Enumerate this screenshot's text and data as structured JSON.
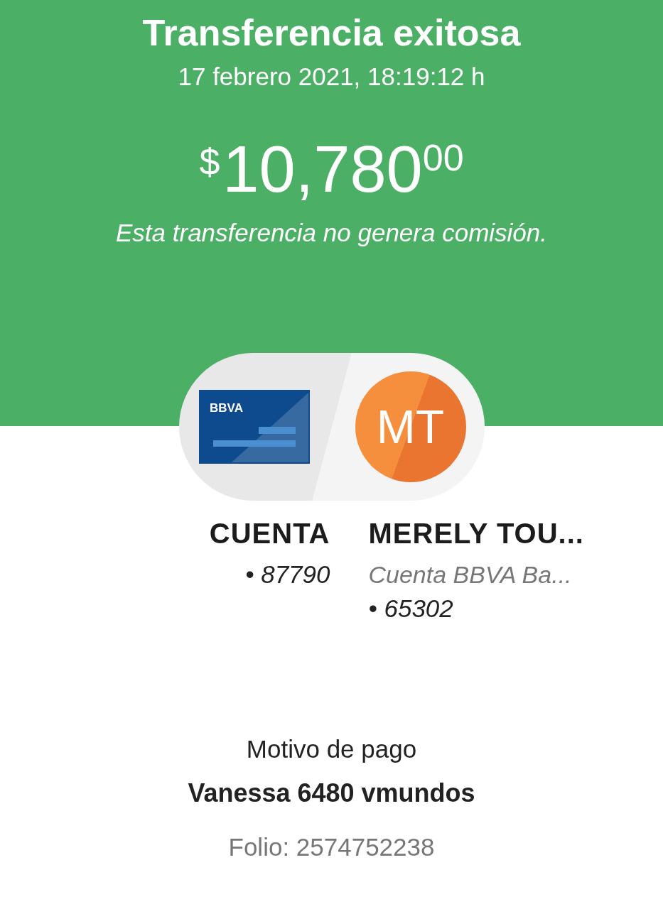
{
  "header": {
    "title": "Transferencia exitosa",
    "datetime": "17 febrero 2021, 18:19:12 h"
  },
  "amount": {
    "currency": "$",
    "integer": "10,780",
    "cents": "00"
  },
  "note": "Esta transferencia no genera comisión.",
  "origin": {
    "bank_logo_text": "BBVA",
    "name": "CUENTA",
    "lines": [
      "• 87790"
    ]
  },
  "destination": {
    "initials": "MT",
    "name": "MERELY TOU...",
    "bank": "Cuenta BBVA Ba...",
    "lines": [
      "• 65302"
    ]
  },
  "payment": {
    "label": "Motivo de pago",
    "value": "Vanessa 6480 vmundos",
    "folio": "Folio: 2574752238"
  }
}
